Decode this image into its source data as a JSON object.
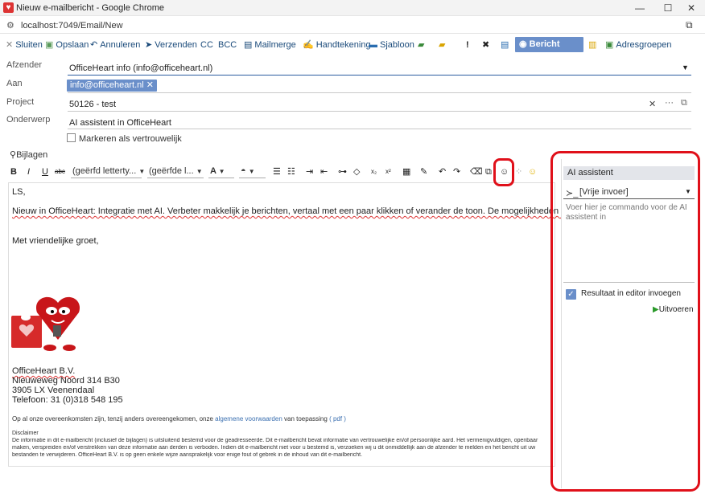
{
  "window": {
    "title": "Nieuw e-mailbericht - Google Chrome",
    "minimize": "—",
    "maximize": "☐",
    "close": "✕"
  },
  "browser": {
    "url": "localhost:7049/Email/New"
  },
  "toolbar": {
    "close": "Sluiten",
    "save": "Opslaan",
    "cancel": "Annuleren",
    "send": "Verzenden",
    "cc": "CC",
    "bcc": "BCC",
    "mailmerge": "Mailmerge",
    "signature": "Handtekening",
    "template": "Sjabloon",
    "priority": "!",
    "trace": "Bericht traceren",
    "address_groups": "Adresgroepen"
  },
  "fields": {
    "from_label": "Afzender",
    "from_value": "OfficeHeart info (info@officeheart.nl)",
    "to_label": "Aan",
    "to_chip": "info@officeheart.nl",
    "project_label": "Project",
    "project_value": "50126 - test",
    "subject_label": "Onderwerp",
    "subject_value": "AI assistent in OfficeHeart",
    "confidential_label": "Markeren als vertrouwelijk",
    "attachments_label": "Bijlagen"
  },
  "editor_toolbar": {
    "font_family": "(geërfd letterty...",
    "font_size": "(geërfde l...",
    "bold": "B",
    "italic": "I",
    "underline": "U",
    "strike": "abc"
  },
  "body": {
    "greeting": "LS,",
    "paragraph": "Nieuw in OfficeHeart: Integratie met AI. Verbeter makkelijk je berichten, vertaal met een paar klikken of verander de toon. De mogelijkheden zijn onbeperkt.",
    "closing": "Met vriendelijke groet,",
    "company": "OfficeHeart B.V.",
    "street": "Nieuweweg Noord 314 B30",
    "city": "3905 LX Veenendaal",
    "phone": "Telefoon: 31 (0)318 548 195",
    "terms_prefix": "Op al onze overeenkomsten zijn, tenzij anders overeengekomen, onze",
    "terms_link": "algemene voorwaarden",
    "terms_suffix": "van toepassing",
    "terms_pdf": "( pdf )",
    "disclaimer_title": "Disclaimer",
    "disclaimer_1": "De informatie in dit e-mailbericht (inclusief de bijlagen) is uitsluitend bestemd voor de geadresseerde. Dit e-mailbericht bevat informatie van vertrouwelijke en/of persoonlijke aard. Het vermenigvuldigen, openbaar",
    "disclaimer_2": "maken, verspreiden en/of verstrekken van deze informatie aan derden is verboden. Indien dit e-mailbericht niet voor u bestemd is, verzoeken wij u dit onmiddellijk aan de afzender te melden en het bericht uit uw",
    "disclaimer_3": "bestanden te verwijderen. OfficeHeart B.V. is op geen enkele wijze aansprakelijk voor enige fout of gebrek in de inhoud van dit e-mailbericht."
  },
  "ai_panel": {
    "title": "AI assistent",
    "mode": "[Vrije invoer]",
    "placeholder": "Voer hier je commando voor de AI assistent in",
    "insert_label": "Resultaat in editor invoegen",
    "run_label": "Uitvoeren"
  },
  "colors": {
    "accent": "#6a8fca",
    "highlight": "#e0101a"
  }
}
